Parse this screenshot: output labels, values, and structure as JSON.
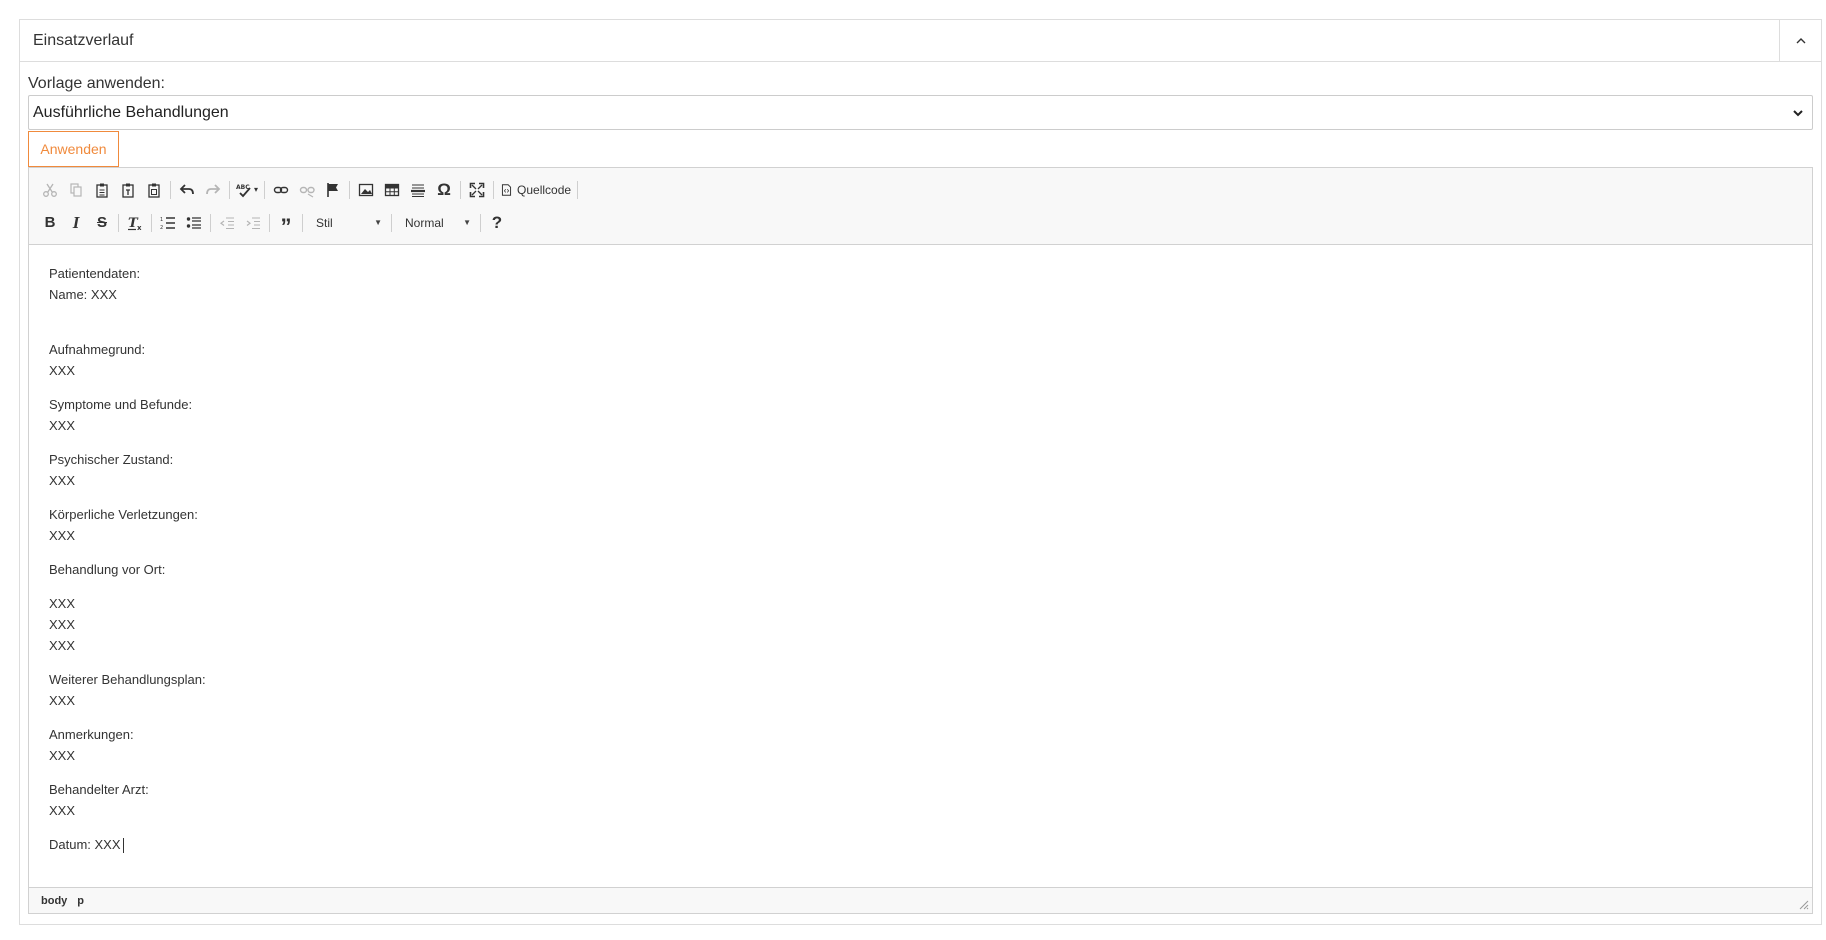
{
  "panel": {
    "title": "Einsatzverlauf",
    "collapse_icon": "chevron-up-icon"
  },
  "template": {
    "label": "Vorlage anwenden:",
    "selected": "Ausführliche Behandlungen",
    "apply_label": "Anwenden"
  },
  "toolbar": {
    "source_label": "Quellcode",
    "style_combo": "Stil",
    "format_combo": "Normal",
    "help_label": "?"
  },
  "content": {
    "patient_heading": "Patientendaten:",
    "patient_name": "Name: XXX",
    "reason_heading": "Aufnahmegrund:",
    "reason_value": "XXX",
    "symptoms_heading": "Symptome und Befunde:",
    "symptoms_value": "XXX",
    "psych_heading": "Psychischer Zustand:",
    "psych_value": "XXX",
    "injuries_heading": "Körperliche Verletzungen:",
    "injuries_value": "XXX",
    "treatment_heading": "Behandlung vor Ort:",
    "treatment_values": [
      "XXX",
      "XXX",
      "XXX"
    ],
    "plan_heading": "Weiterer Behandlungsplan:",
    "plan_value": "XXX",
    "notes_heading": "Anmerkungen:",
    "notes_value": "XXX",
    "doctor_heading": "Behandelter Arzt:",
    "doctor_value": "XXX",
    "date_line": "Datum: XXX"
  },
  "statusbar": {
    "path": [
      "body",
      "p"
    ]
  },
  "colors": {
    "accent": "#f08a3c",
    "border": "#dddddd",
    "toolbar_bg": "#f8f8f8"
  }
}
